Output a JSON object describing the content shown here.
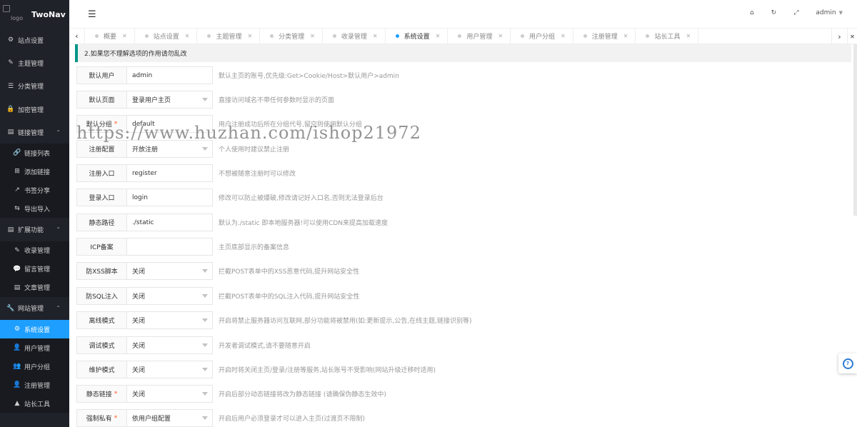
{
  "brand": {
    "logo_alt": "logo",
    "name": "TwoNav"
  },
  "sidebar": {
    "items": [
      {
        "label": "站点设置",
        "icon": "gear-icon",
        "glyph": "⚙"
      },
      {
        "label": "主题管理",
        "icon": "brush-icon",
        "glyph": "✎"
      },
      {
        "label": "分类管理",
        "icon": "list-icon",
        "glyph": "☰"
      },
      {
        "label": "加密管理",
        "icon": "lock-icon",
        "glyph": "🔒"
      },
      {
        "label": "链接管理",
        "icon": "folder-icon",
        "glyph": "▤",
        "expanded": true,
        "children": [
          {
            "label": "链接列表",
            "icon": "link-icon",
            "glyph": "🔗"
          },
          {
            "label": "添加链接",
            "icon": "plus-square-icon",
            "glyph": "⊞"
          },
          {
            "label": "书签分享",
            "icon": "share-icon",
            "glyph": "↗"
          },
          {
            "label": "导出导入",
            "icon": "swap-icon",
            "glyph": "⇆"
          }
        ]
      },
      {
        "label": "扩展功能",
        "icon": "folder-icon",
        "glyph": "▤",
        "expanded": true,
        "children": [
          {
            "label": "收录管理",
            "icon": "pencil-icon",
            "glyph": "✎"
          },
          {
            "label": "留言管理",
            "icon": "comment-icon",
            "glyph": "💬"
          },
          {
            "label": "文章管理",
            "icon": "document-icon",
            "glyph": "▤"
          }
        ]
      },
      {
        "label": "网站管理",
        "icon": "wrench-icon",
        "glyph": "🔧",
        "expanded": true,
        "children": [
          {
            "label": "系统设置",
            "icon": "gears-icon",
            "glyph": "⚙",
            "active": true
          },
          {
            "label": "用户管理",
            "icon": "user-icon",
            "glyph": "👤"
          },
          {
            "label": "用户分组",
            "icon": "users-icon",
            "glyph": "👥"
          },
          {
            "label": "注册管理",
            "icon": "user-plus-icon",
            "glyph": "👤"
          },
          {
            "label": "站长工具",
            "icon": "warning-icon",
            "glyph": "▲"
          }
        ]
      }
    ]
  },
  "header": {
    "user": "admin"
  },
  "tabs": [
    {
      "label": "概要"
    },
    {
      "label": "站点设置"
    },
    {
      "label": "主题管理"
    },
    {
      "label": "分类管理"
    },
    {
      "label": "收录管理"
    },
    {
      "label": "系统设置",
      "active": true
    },
    {
      "label": "用户管理"
    },
    {
      "label": "用户分组"
    },
    {
      "label": "注册管理"
    },
    {
      "label": "站长工具"
    }
  ],
  "notice": "2.如果您不理解选项的作用请勿乱改",
  "watermark": "https://www.huzhan.com/ishop21972",
  "settings": [
    {
      "label": "默认用户",
      "value": "admin",
      "type": "input",
      "tip": "默认主页的账号,优先级:Get>Cookie/Host>默认用户>admin"
    },
    {
      "label": "默认页面",
      "value": "登录用户主页",
      "type": "select",
      "tip": "直接访问域名不带任何参数时显示的页面"
    },
    {
      "label": "默认分组",
      "required": true,
      "value": "default",
      "type": "input",
      "tip": "用户注册成功后所在分组代号,留空则使用默认分组"
    },
    {
      "label": "注册配置",
      "value": "开放注册",
      "type": "select",
      "tip": "个人使用时建议禁止注册"
    },
    {
      "label": "注册入口",
      "value": "register",
      "type": "input",
      "tip": "不想被随意注册时可以修改"
    },
    {
      "label": "登录入口",
      "value": "login",
      "type": "input",
      "tip": "修改可以防止被爆破,修改请记好入口名,否则无法登录后台"
    },
    {
      "label": "静态路径",
      "value": "./static",
      "type": "input",
      "tip": "默认为./static 即本地服务器!可以使用CDN来提高加载速度"
    },
    {
      "label": "ICP备案",
      "value": "",
      "type": "input",
      "tip": "主页底部显示的备案信息"
    },
    {
      "label": "防XSS脚本",
      "value": "关闭",
      "type": "select",
      "tip": "拦截POST表单中的XSS恶意代码,提升网站安全性"
    },
    {
      "label": "防SQL注入",
      "value": "关闭",
      "type": "select",
      "tip": "拦截POST表单中的SQL注入代码,提升网站安全性"
    },
    {
      "label": "离线模式",
      "value": "关闭",
      "type": "select",
      "tip": "开启将禁止服务器访问互联网,部分功能将被禁用(如:更新提示,公告,在线主题,链接识别等)"
    },
    {
      "label": "调试模式",
      "value": "关闭",
      "type": "select",
      "tip": "开发者调试模式,请不要随意开启"
    },
    {
      "label": "维护模式",
      "value": "关闭",
      "type": "select",
      "tip": "开启时将关闭主页/登录/注册等服务,站长账号不受影响(网站升级迁移时适用)"
    },
    {
      "label": "静态链接",
      "required": true,
      "value": "关闭",
      "type": "select",
      "tip": "开启后部分动态链接将改为静态链接 (请确保伪静态生效中)"
    },
    {
      "label": "强制私有",
      "required": true,
      "value": "依用户组配置",
      "type": "select",
      "tip": "开启后用户必须登录才可以进入主页(过渡页不限制)"
    }
  ]
}
